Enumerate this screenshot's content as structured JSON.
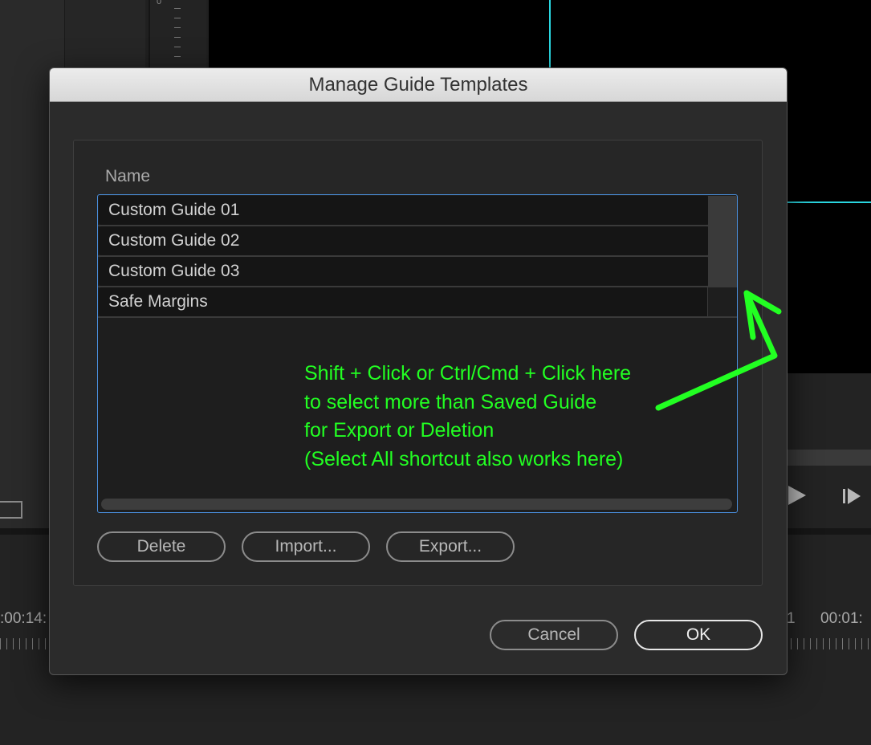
{
  "background": {
    "ruler_zero": "0",
    "timecode_left": ":00:14:",
    "timecode_right_partial": "1",
    "timecode_right": "00:01:",
    "guide_color": "#2ad6e0"
  },
  "dialog": {
    "title": "Manage Guide Templates",
    "column_header": "Name",
    "templates": [
      {
        "name": "Custom Guide 01"
      },
      {
        "name": "Custom Guide 02"
      },
      {
        "name": "Custom Guide 03"
      },
      {
        "name": "Safe Margins"
      }
    ],
    "buttons": {
      "delete": "Delete",
      "import": "Import...",
      "export": "Export...",
      "cancel": "Cancel",
      "ok": "OK"
    }
  },
  "annotation": {
    "color": "#22ff22",
    "lines": [
      "Shift + Click or Ctrl/Cmd + Click here",
      "to select more than Saved Guide",
      "for Export or Deletion",
      "(Select All shortcut also works here)"
    ]
  },
  "icons": [
    "play-icon",
    "step-forward-icon",
    "export-frame-icon",
    "arrow-annotation-icon"
  ]
}
